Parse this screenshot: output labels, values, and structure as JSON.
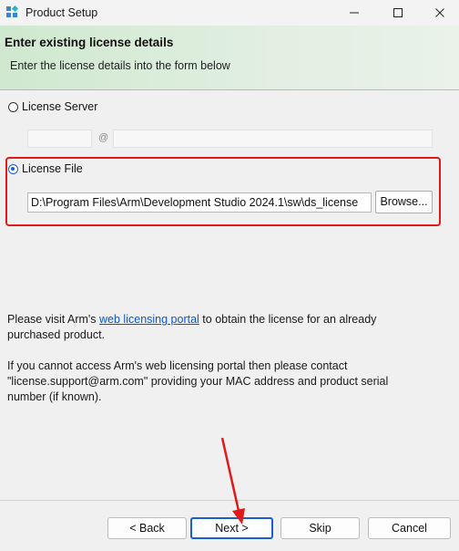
{
  "window": {
    "title": "Product Setup"
  },
  "banner": {
    "title": "Enter existing license details",
    "subtitle": "Enter the license details into the form below"
  },
  "license_server": {
    "label": "License Server",
    "selected": false,
    "separator": "@",
    "port_value": "",
    "host_value": ""
  },
  "license_file": {
    "label": "License File",
    "selected": true,
    "path_value": "D:\\Program Files\\Arm\\Development Studio 2024.1\\sw\\ds_license",
    "browse_label": "Browse..."
  },
  "info": {
    "p1_before": "Please visit Arm's ",
    "p1_link": "web licensing portal",
    "p1_after": " to obtain the license for an already purchased product.",
    "p2": "If you cannot access Arm's web licensing portal then please contact \"license.support@arm.com\" providing your MAC address and product serial number (if known)."
  },
  "buttons": {
    "back": "< Back",
    "next": "Next >",
    "skip": "Skip",
    "cancel": "Cancel"
  },
  "colors": {
    "annotation_red": "#e01919",
    "accent_blue": "#1a5fd0",
    "banner_green": "#cfe8cf"
  }
}
